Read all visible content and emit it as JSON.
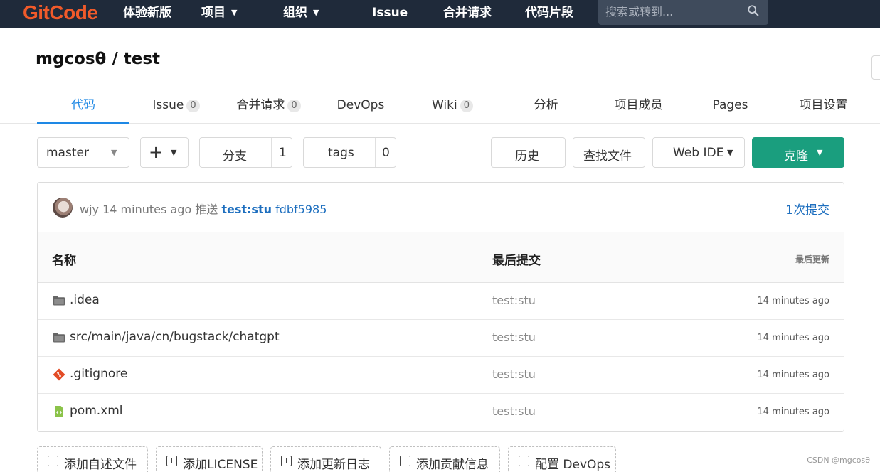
{
  "nav": {
    "logo": "GitCode",
    "items": [
      "体验新版",
      "项目",
      "组织",
      "Issue",
      "合并请求",
      "代码片段"
    ],
    "search_placeholder": "搜索或转到..."
  },
  "project": {
    "title": "mgcosθ / test"
  },
  "tabs": [
    {
      "label": "代码",
      "count": null
    },
    {
      "label": "Issue",
      "count": "0"
    },
    {
      "label": "合并请求",
      "count": "0"
    },
    {
      "label": "DevOps",
      "count": null
    },
    {
      "label": "Wiki",
      "count": "0"
    },
    {
      "label": "分析",
      "count": null
    },
    {
      "label": "项目成员",
      "count": null
    },
    {
      "label": "Pages",
      "count": null
    },
    {
      "label": "项目设置",
      "count": null
    }
  ],
  "toolbar": {
    "branch": "master",
    "add": "+",
    "branches_label": "分支",
    "branches_count": "1",
    "tags_label": "tags",
    "tags_count": "0",
    "history": "历史",
    "find_file": "查找文件",
    "web_ide": "Web IDE",
    "clone": "克隆"
  },
  "commit": {
    "author": "wjy",
    "time": "14 minutes ago",
    "action": "推送",
    "message": "test:stu",
    "sha": "fdbf5985",
    "count_label": "1次提交"
  },
  "table": {
    "headers": {
      "name": "名称",
      "last_commit": "最后提交",
      "last_update": "最后更新"
    },
    "rows": [
      {
        "icon": "folder-icon",
        "name": ".idea",
        "commit": "test:stu",
        "updated": "14 minutes ago"
      },
      {
        "icon": "folder-icon",
        "name": "src/main/java/cn/bugstack/chatgpt",
        "commit": "test:stu",
        "updated": "14 minutes ago"
      },
      {
        "icon": "git-file-icon",
        "name": ".gitignore",
        "commit": "test:stu",
        "updated": "14 minutes ago"
      },
      {
        "icon": "xml-file-icon",
        "name": "pom.xml",
        "commit": "test:stu",
        "updated": "14 minutes ago"
      }
    ]
  },
  "actions": [
    "添加自述文件",
    "添加LICENSE",
    "添加更新日志",
    "添加贡献信息",
    "配置 DevOps"
  ],
  "watermark": "CSDN @mgcosθ",
  "colors": {
    "nav_bg": "#1f2a3a",
    "accent": "#1e88e5",
    "clone_green": "#1a9e7e",
    "logo": "#f05a2a"
  }
}
